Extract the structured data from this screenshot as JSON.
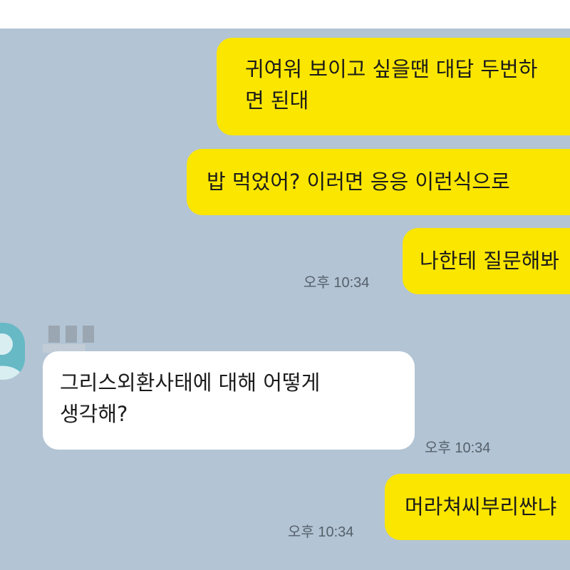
{
  "chat": {
    "messages": [
      {
        "sender": "me",
        "text_lines": [
          "귀여워 보이고 싶을땐 대답 두번하",
          "면 된대"
        ]
      },
      {
        "sender": "me",
        "text_lines": [
          "밥 먹었어? 이러면 응응 이런식으로"
        ]
      },
      {
        "sender": "me",
        "text_lines": [
          "나한테 질문해봐"
        ],
        "time": "오후 10:34"
      },
      {
        "sender": "friend",
        "text_lines": [
          "그리스외환사태에 대해 어떻게",
          "생각해?"
        ],
        "time": "오후 10:34"
      },
      {
        "sender": "me",
        "text_lines": [
          "머라쳐씨부리싼냐"
        ],
        "time": "오후 10:34"
      }
    ]
  },
  "colors": {
    "background": "#b3c4d4",
    "my_bubble": "#fbe600",
    "friend_bubble": "#ffffff",
    "avatar": "#66b9c5"
  }
}
